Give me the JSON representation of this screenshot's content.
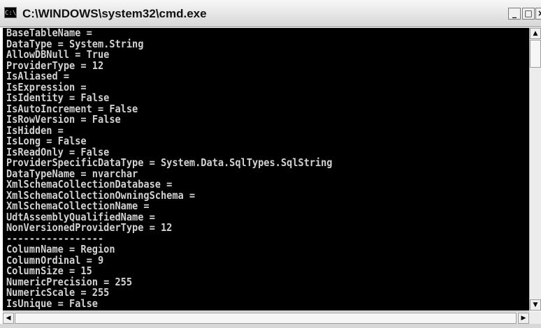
{
  "window": {
    "icon_label": "C:\\",
    "title": "C:\\WINDOWS\\system32\\cmd.exe",
    "minimize_label": "_",
    "maximize_label": "□",
    "close_label": "×"
  },
  "console": {
    "lines": [
      "BaseTableName =",
      "DataType = System.String",
      "AllowDBNull = True",
      "ProviderType = 12",
      "IsAliased =",
      "IsExpression =",
      "IsIdentity = False",
      "IsAutoIncrement = False",
      "IsRowVersion = False",
      "IsHidden =",
      "IsLong = False",
      "IsReadOnly = False",
      "ProviderSpecificDataType = System.Data.SqlTypes.SqlString",
      "DataTypeName = nvarchar",
      "XmlSchemaCollectionDatabase =",
      "XmlSchemaCollectionOwningSchema =",
      "XmlSchemaCollectionName =",
      "UdtAssemblyQualifiedName =",
      "NonVersionedProviderType = 12",
      "-----------------",
      "ColumnName = Region",
      "ColumnOrdinal = 9",
      "ColumnSize = 15",
      "NumericPrecision = 255",
      "NumericScale = 255",
      "IsUnique = False"
    ]
  },
  "scrollbars": {
    "up_arrow": "▲",
    "down_arrow": "▼",
    "left_arrow": "◀",
    "right_arrow": "▶"
  }
}
